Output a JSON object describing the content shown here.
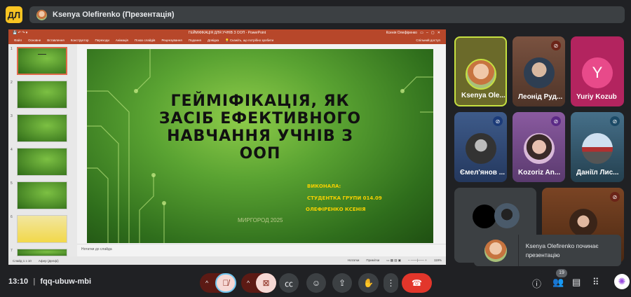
{
  "app": {
    "logo": "ДЛ",
    "presenter_label": "Ksenya Olefirenko (Презентація)"
  },
  "powerpoint": {
    "title": "ГЕЙМІФІКАЦІЯ ДЛЯ УЧНІВ З ООП - PowerPoint",
    "user": "Ксенія Олефіренко",
    "tabs": [
      "Файл",
      "Основне",
      "Вставлення",
      "Конструктор",
      "Переходи",
      "Анімація",
      "Показ слайдів",
      "Рецензування",
      "Подання",
      "Довідка"
    ],
    "tell_me": "Скажіть, що потрібно зробити",
    "share": "Спільний доступ",
    "thumbnails": [
      "1",
      "2",
      "3",
      "4",
      "5",
      "6",
      "7"
    ],
    "slide": {
      "title": "ГЕЙМІФІКАЦІЯ, ЯК ЗАСІБ ЕФЕКТИВНОГО НАВЧАННЯ УЧНІВ З ООП",
      "line1": "ВИКОНАЛА:",
      "line2": "СТУДЕНТКА ГРУПИ 014.09",
      "line3": "ОЛЕФІРЕНКО КСЕНІЯ",
      "city": "МИРГОРОД 2025"
    },
    "notes_placeholder": "Нотатки до слайда",
    "status": {
      "slide": "Слайд 1 з 10",
      "lang": "Афер (Делфі)",
      "notes": "Нотатки",
      "comments": "Примітки",
      "zoom": "119%"
    }
  },
  "participants": [
    {
      "name": "Ksenya Ole...",
      "muted": false,
      "color": "#6b6a2a"
    },
    {
      "name": "Леонід Руд...",
      "muted": true,
      "color": "#6d4a3a"
    },
    {
      "name": "Yuriy Kozub",
      "muted": false,
      "color": "#b3245f",
      "initial": "Y"
    },
    {
      "name": "Ємел'янов ...",
      "muted": true,
      "color": "#2f4a78"
    },
    {
      "name": "Kozoriz An...",
      "muted": true,
      "color": "#6b3f7a"
    },
    {
      "name": "Даніїл Лис...",
      "muted": true,
      "color": "#2f4f66"
    }
  ],
  "toast": "Ksenya Olefirenko починає презентацію",
  "bottom": {
    "time": "13:10",
    "meeting_code": "fqq-ubuw-mbi",
    "people_count": "19"
  }
}
